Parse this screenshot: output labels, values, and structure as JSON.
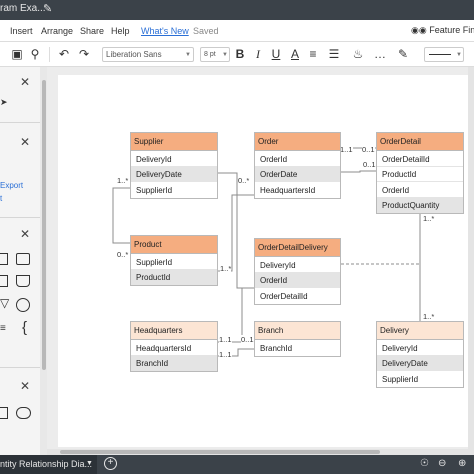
{
  "window": {
    "doc_title": "ram Exa...",
    "tab_label": "ntity Relationship Dia..."
  },
  "menu": {
    "insert": "Insert",
    "arrange": "Arrange",
    "share": "Share",
    "help": "Help",
    "whats_new": "What's New",
    "saved": "Saved",
    "feature_find": "Feature Find"
  },
  "toolbar": {
    "font": "Liberation Sans",
    "font_size": "8 pt",
    "bold": "B",
    "italic": "I",
    "underline": "U",
    "text_a": "A"
  },
  "sidebar": {
    "export_link": "Export",
    "link2": "t"
  },
  "entities": {
    "supplier": {
      "title": "Supplier",
      "fields": [
        "DeliveryId",
        "DeliveryDate",
        "SupplierId"
      ]
    },
    "order": {
      "title": "Order",
      "fields": [
        "OrderId",
        "OrderDate",
        "HeadquartersId"
      ]
    },
    "orderdetail": {
      "title": "OrderDetail",
      "fields": [
        "OrderDetailId",
        "ProductId",
        "OrderId",
        "ProductQuantity"
      ]
    },
    "product": {
      "title": "Product",
      "fields": [
        "SupplierId",
        "ProductId"
      ]
    },
    "orderdetaildelivery": {
      "title": "OrderDetailDelivery",
      "fields": [
        "DeliveryId",
        "OrderId",
        "OrderDetailId"
      ]
    },
    "headquarters": {
      "title": "Headquarters",
      "fields": [
        "HeadquartersId",
        "BranchId"
      ]
    },
    "branch": {
      "title": "Branch",
      "fields": [
        "BranchId"
      ]
    },
    "delivery": {
      "title": "Delivery",
      "fields": [
        "DeliveryId",
        "DeliveryDate",
        "SupplierId"
      ]
    }
  },
  "cardinality": {
    "c1": "1..1",
    "c2": "0..1",
    "c3": "0..1",
    "c4": "1..*",
    "c5": "0..*",
    "c6": "0..*",
    "c7": "1..*",
    "c8": "1..*",
    "c9": "1..*",
    "c10": "1..1",
    "c11": "0..1",
    "c12": "1..1"
  },
  "colors": {
    "header_orange": "#f5ad80",
    "header_light": "#fce5d4",
    "row_grey": "#e4e4e4",
    "chrome_dark": "#3b4249",
    "link_blue": "#2a6fd6"
  },
  "icons": [
    "pencil-icon",
    "image-icon",
    "search-icon",
    "undo-icon",
    "redo-icon",
    "bold-icon",
    "italic-icon",
    "underline-icon",
    "text-color-icon",
    "align-icon",
    "list-icon",
    "fill-icon",
    "binoculars-icon",
    "close-icon",
    "add-page-icon",
    "compass-icon",
    "zoom-icon"
  ]
}
